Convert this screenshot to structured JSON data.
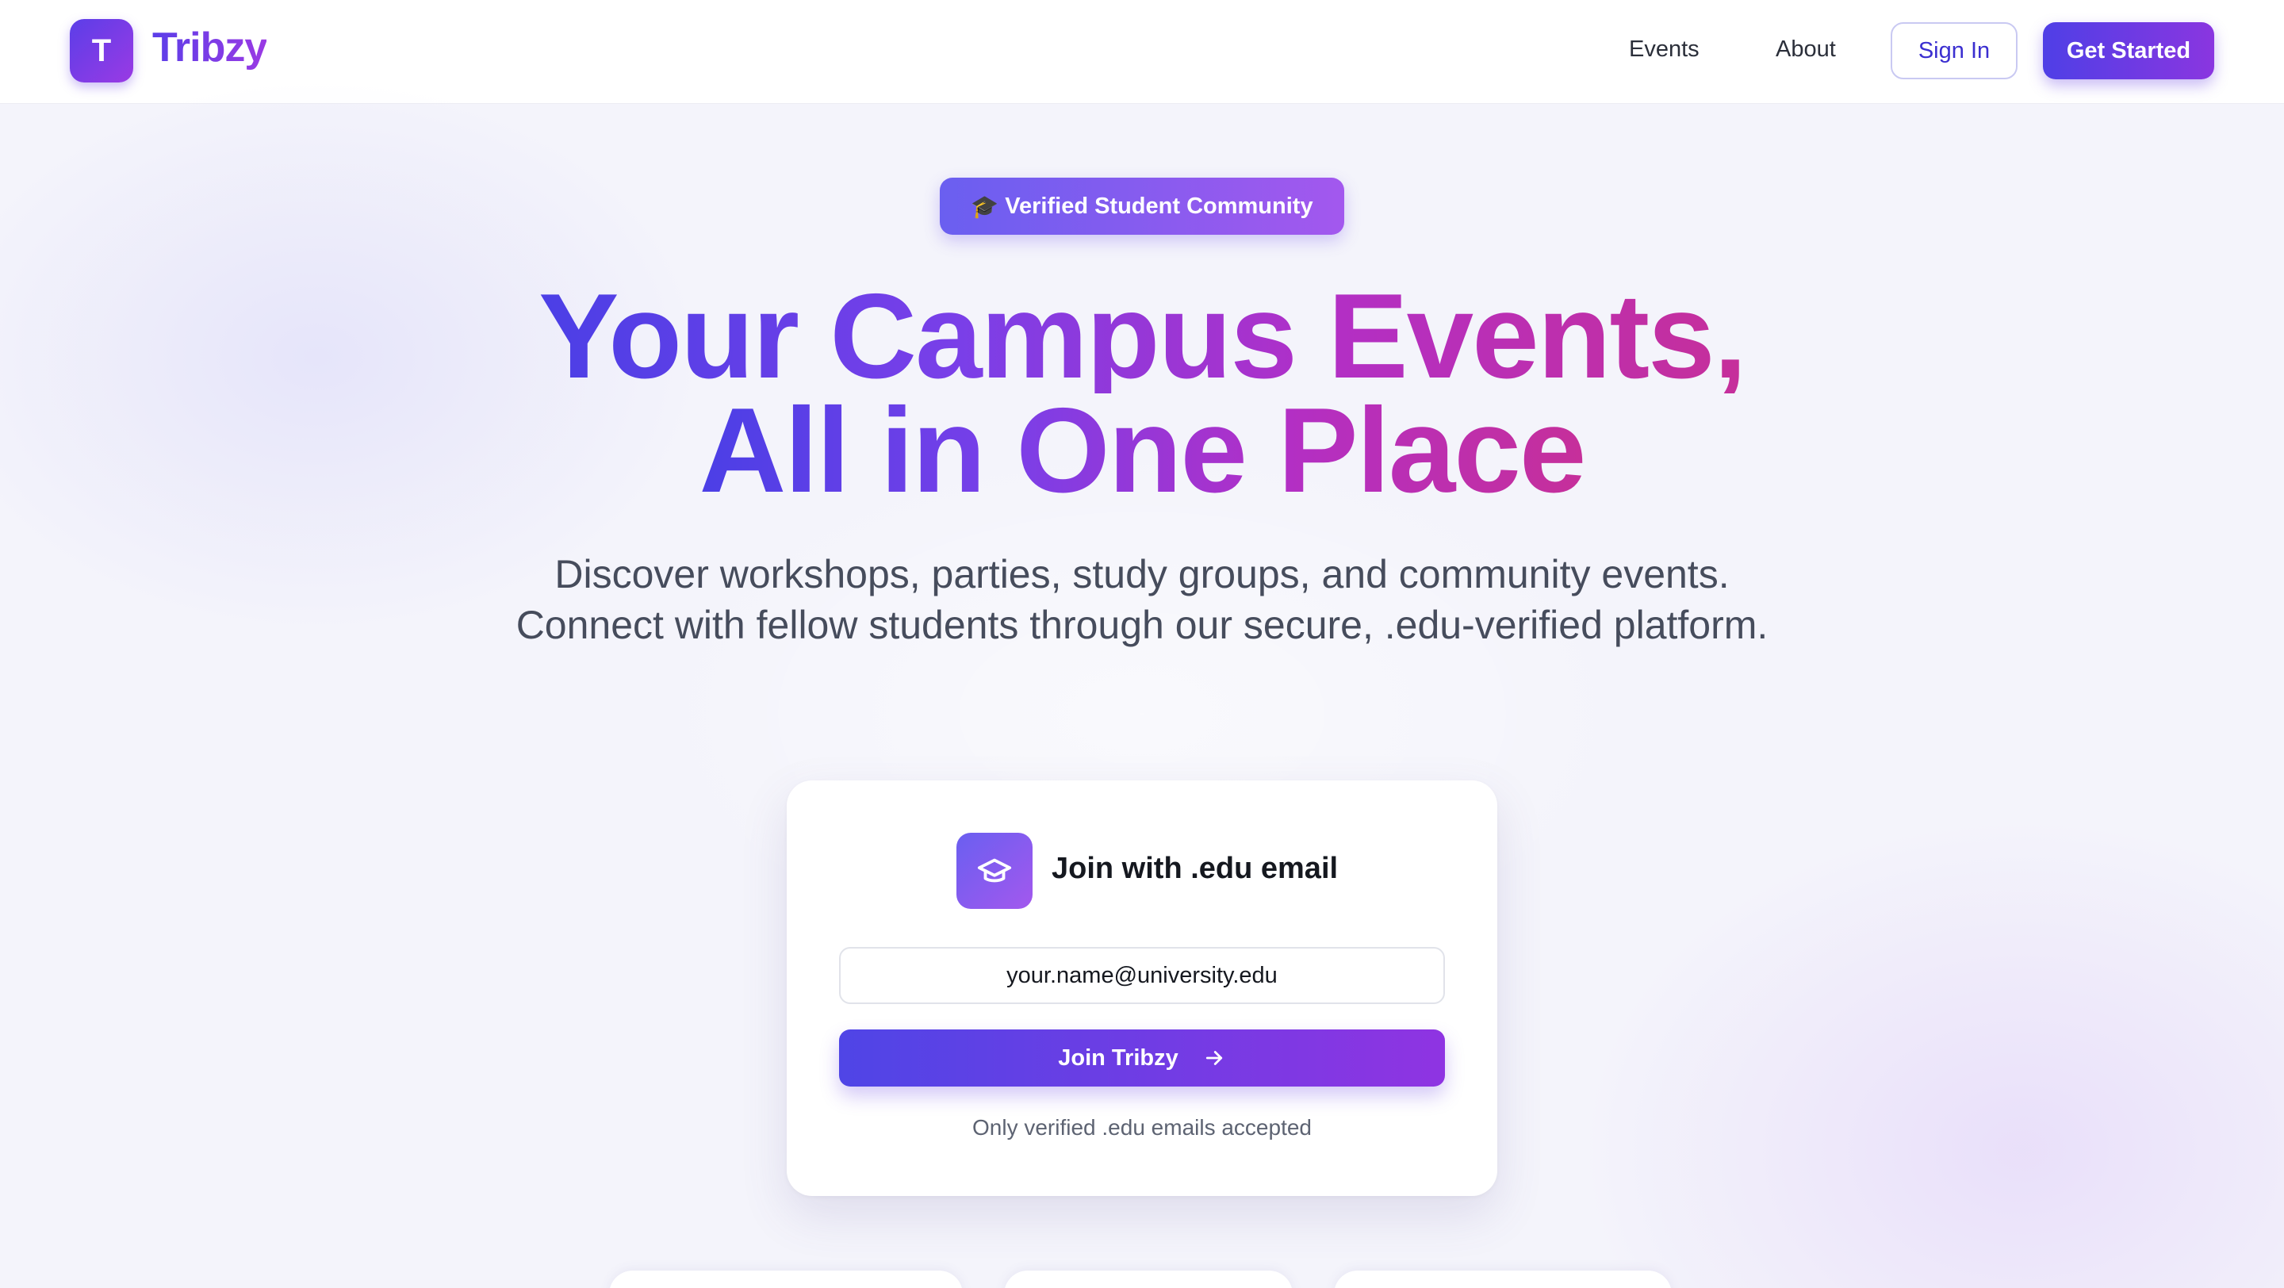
{
  "nav": {
    "logo_letter": "T",
    "brand": "Tribzy",
    "links": [
      "Events",
      "About"
    ],
    "sign_in": "Sign In",
    "get_started": "Get Started"
  },
  "hero": {
    "badge_icon": "graduation-cap-emoji",
    "badge_emoji": "🎓",
    "badge_text": "Verified Student Community",
    "headline_line1": "Your Campus Events,",
    "headline_line2": "All in One Place",
    "subtext": "Discover workshops, parties, study groups, and community events. Connect with fellow students through our secure, .edu-verified platform."
  },
  "card": {
    "icon": "graduation-cap-icon",
    "title": "Join with .edu email",
    "email_placeholder": "your.name@university.edu",
    "join_button": "Join Tribzy",
    "join_icon": "arrow-right-icon",
    "note": "Only verified .edu emails accepted"
  },
  "colors": {
    "brand_start": "#4f3fe6",
    "brand_end": "#9a3ae4",
    "headline_end": "#c62f9a",
    "text_dark": "#15181f",
    "text_muted": "#5d6372"
  }
}
